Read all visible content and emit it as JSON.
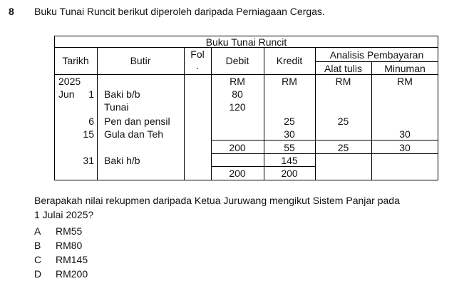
{
  "question": {
    "number": "8",
    "stem": "Buku Tunai Runcit berikut diperoleh daripada Perniagaan Cergas."
  },
  "table": {
    "title": "Buku Tunai Runcit",
    "headers": {
      "tarikh": "Tarikh",
      "butir": "Butir",
      "fol": "Fol",
      "fol_dot": ".",
      "debit": "Debit",
      "kredit": "Kredit",
      "analisis": "Analisis Pembayaran",
      "alat_tulis": "Alat tulis",
      "minuman": "Minuman"
    },
    "units": {
      "year": "2025",
      "debit": "RM",
      "kredit": "RM",
      "alat_tulis": "RM",
      "minuman": "RM"
    },
    "rows": [
      {
        "month": "Jun",
        "day": "1",
        "butir": "Baki b/b",
        "debit": "80",
        "kredit": "",
        "alat_tulis": "",
        "minuman": ""
      },
      {
        "month": "",
        "day": "",
        "butir": "Tunai",
        "debit": "120",
        "kredit": "",
        "alat_tulis": "",
        "minuman": ""
      },
      {
        "month": "",
        "day": "6",
        "butir": "Pen dan pensil",
        "debit": "",
        "kredit": "25",
        "alat_tulis": "25",
        "minuman": ""
      },
      {
        "month": "",
        "day": "15",
        "butir": "Gula dan Teh",
        "debit": "",
        "kredit": "30",
        "alat_tulis": "",
        "minuman": "30"
      }
    ],
    "totals_1": {
      "debit": "200",
      "kredit": "55",
      "alat_tulis": "25",
      "minuman": "30"
    },
    "closing": {
      "day": "31",
      "butir": "Baki h/b",
      "kredit": "145"
    },
    "totals_2": {
      "debit": "200",
      "kredit": "200"
    }
  },
  "prompt": {
    "line1": "Berapakah nilai rekupmen daripada Ketua Juruwang mengikut Sistem Panjar pada",
    "line2": "1 Julai 2025?"
  },
  "options": [
    {
      "letter": "A",
      "text": "RM55"
    },
    {
      "letter": "B",
      "text": "RM80"
    },
    {
      "letter": "C",
      "text": "RM145"
    },
    {
      "letter": "D",
      "text": "RM200"
    }
  ]
}
